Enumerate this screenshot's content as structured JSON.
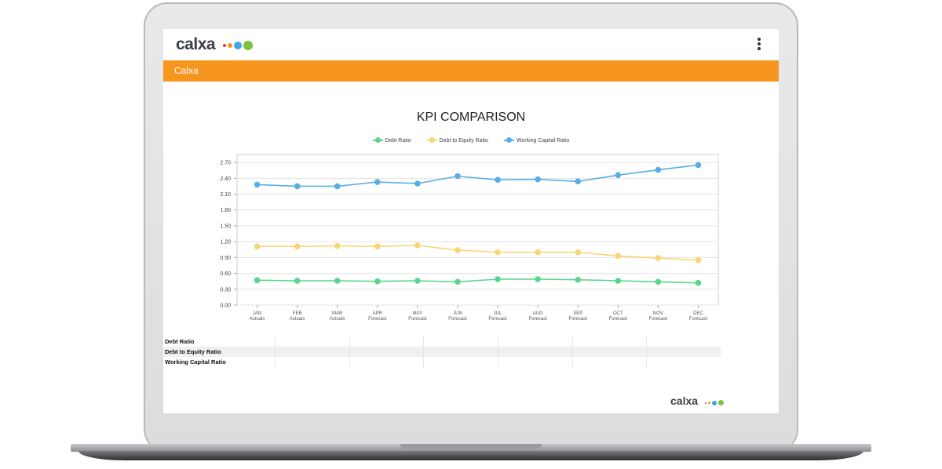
{
  "app": {
    "logo_text": "calxa",
    "logo_dot_colors": [
      "#e8402f",
      "#f7961e",
      "#3ea6e0",
      "#7cc243"
    ],
    "section_title": "Calxa",
    "menu_icon": "kebab-menu-icon"
  },
  "chart_data": {
    "type": "line",
    "title": "KPI COMPARISON",
    "categories": [
      [
        "JAN",
        "Actuals"
      ],
      [
        "FEB",
        "Actuals"
      ],
      [
        "MAR",
        "Actuals"
      ],
      [
        "APR",
        "Forecast"
      ],
      [
        "MAY",
        "Forecast"
      ],
      [
        "JUN",
        "Forecast"
      ],
      [
        "JUL",
        "Forecast"
      ],
      [
        "AUG",
        "Forecast"
      ],
      [
        "SEP",
        "Forecast"
      ],
      [
        "OCT",
        "Forecast"
      ],
      [
        "NOV",
        "Forecast"
      ],
      [
        "DEC",
        "Forecast"
      ]
    ],
    "series": [
      {
        "name": "Debt Ratio",
        "color": "#5cd48a",
        "values": [
          0.47,
          0.46,
          0.46,
          0.45,
          0.46,
          0.44,
          0.49,
          0.49,
          0.48,
          0.46,
          0.44,
          0.42
        ]
      },
      {
        "name": "Debt to Equity Ratio",
        "color": "#f9d575",
        "values": [
          1.11,
          1.11,
          1.12,
          1.11,
          1.13,
          1.04,
          1.0,
          1.0,
          1.0,
          0.93,
          0.89,
          0.85
        ]
      },
      {
        "name": "Working Capital Ratio",
        "color": "#5aaee3",
        "values": [
          2.28,
          2.25,
          2.25,
          2.33,
          2.3,
          2.44,
          2.37,
          2.38,
          2.34,
          2.46,
          2.56,
          2.65
        ]
      }
    ],
    "yticks": [
      "0.00",
      "0.30",
      "0.60",
      "0.90",
      "1.20",
      "1.50",
      "1.80",
      "2.10",
      "2.40",
      "2.70"
    ],
    "ylim": [
      0,
      2.85
    ],
    "grid": true,
    "legend_position": "top"
  },
  "table": {
    "rows": [
      "Debt Ratio",
      "Debt to Equity Ratio",
      "Working Capital Ratio"
    ]
  },
  "footer": {
    "logo_text": "calxa"
  }
}
